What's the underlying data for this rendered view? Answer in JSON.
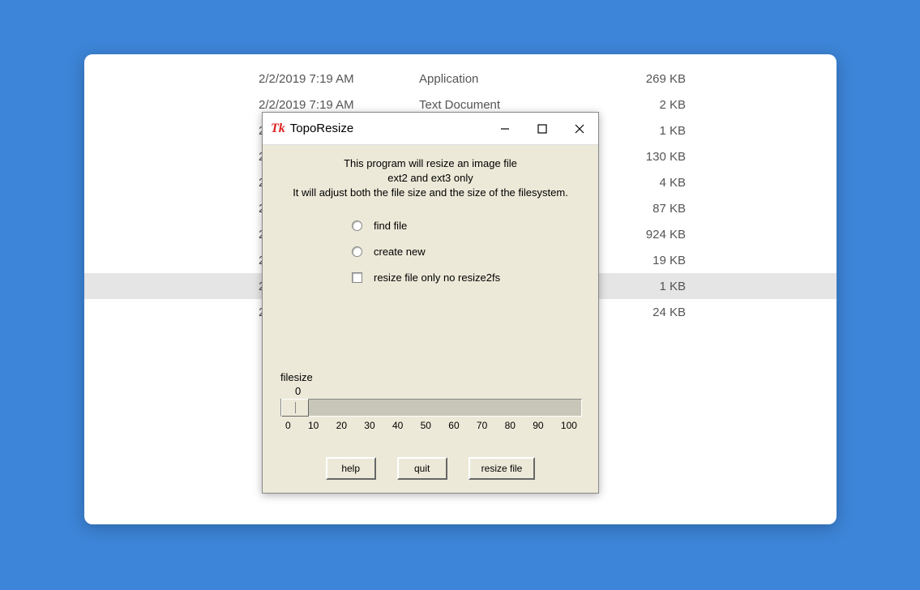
{
  "file_rows": [
    {
      "date": "2/2/2019 7:19 AM",
      "type": "Application",
      "size": "269 KB",
      "selected": false
    },
    {
      "date": "2/2/2019 7:19 AM",
      "type": "Text Document",
      "size": "2 KB",
      "selected": false
    },
    {
      "date": "2",
      "type": "",
      "size": "1 KB",
      "selected": false
    },
    {
      "date": "2",
      "type": "",
      "size": "130 KB",
      "selected": false
    },
    {
      "date": "2",
      "type": "",
      "size": "4 KB",
      "selected": false
    },
    {
      "date": "2",
      "type": "",
      "size": "87 KB",
      "selected": false
    },
    {
      "date": "2",
      "type": "",
      "size": "924 KB",
      "selected": false
    },
    {
      "date": "2",
      "type": "",
      "size": "19 KB",
      "selected": false
    },
    {
      "date": "2",
      "type": "",
      "size": "1 KB",
      "selected": true
    },
    {
      "date": "2",
      "type": "",
      "size": "24 KB",
      "selected": false
    }
  ],
  "dialog": {
    "title": "TopoResize",
    "intro_line1": "This program will resize an  image file",
    "intro_line2": "ext2 and ext3 only",
    "intro_line3": "It will adjust both the file size and the size of the filesystem.",
    "option_find": "find file",
    "option_create": "create new",
    "option_resize_only": "resize file only no resize2fs",
    "slider_label": "filesize",
    "slider_value": "0",
    "ticks": [
      "0",
      "10",
      "20",
      "30",
      "40",
      "50",
      "60",
      "70",
      "80",
      "90",
      "100"
    ],
    "btn_help": "help",
    "btn_quit": "quit",
    "btn_resize": "resize file"
  }
}
